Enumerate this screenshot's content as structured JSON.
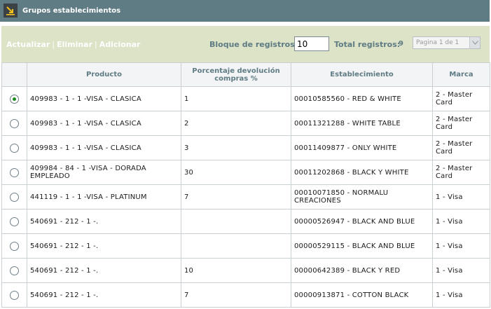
{
  "window": {
    "title": "Grupos establecimientos",
    "icon": "arrow-down-right-icon"
  },
  "toolbar": {
    "actions": [
      "Actualizar",
      "Eliminar",
      "Adicionar"
    ],
    "separator": "|",
    "bloque_label": "Bloque de registros:",
    "bloque_value": "10",
    "total_label": "Total registros:",
    "total_value": "9",
    "page_select": "Pagina 1 de 1"
  },
  "table": {
    "headers": [
      "",
      "Producto",
      "Porcentaje devolución compras %",
      "Establecimiento",
      "Marca"
    ],
    "rows": [
      {
        "selected": true,
        "producto": "409983 - 1 - 1 -VISA - CLASICA",
        "porcentaje": "1",
        "establecimiento": "00010585560 - RED & WHITE",
        "marca": "2 - Master Card"
      },
      {
        "selected": false,
        "producto": "409983 - 1 - 1 -VISA - CLASICA",
        "porcentaje": "2",
        "establecimiento": "00011321288 - WHITE TABLE",
        "marca": "2 - Master Card"
      },
      {
        "selected": false,
        "producto": "409983 - 1 - 1 -VISA - CLASICA",
        "porcentaje": "3",
        "establecimiento": "00011409877 - ONLY WHITE",
        "marca": "2 - Master Card"
      },
      {
        "selected": false,
        "producto": "409984 - 84 - 1 -VISA - DORADA EMPLEADO",
        "porcentaje": "30",
        "establecimiento": "00011202868 - BLACK Y WHITE",
        "marca": "2 - Master Card"
      },
      {
        "selected": false,
        "producto": "441119 - 1 - 1 -VISA - PLATINUM",
        "porcentaje": "7",
        "establecimiento": "00010071850 - NORMALU CREACIONES",
        "marca": "1 - Visa"
      },
      {
        "selected": false,
        "producto": "540691 - 212 - 1 -.",
        "porcentaje": "",
        "establecimiento": "00000526947 - BLACK AND BLUE",
        "marca": "1 - Visa"
      },
      {
        "selected": false,
        "producto": "540691 - 212 - 1 -.",
        "porcentaje": "",
        "establecimiento": "00000529115 - BLACK AND BLUE",
        "marca": "1 - Visa"
      },
      {
        "selected": false,
        "producto": "540691 - 212 - 1 -.",
        "porcentaje": "10",
        "establecimiento": "00000642389 - BLACK Y RED",
        "marca": "1 - Visa"
      },
      {
        "selected": false,
        "producto": "540691 - 212 - 1 -.",
        "porcentaje": "7",
        "establecimiento": "00000913871 - COTTON BLACK",
        "marca": "1 - Visa"
      }
    ]
  },
  "colors": {
    "titlebar": "#5f7b84",
    "toolbar": "#dce3c6",
    "header_text": "#5f7b84",
    "radio_checked": "#1e8a1e"
  }
}
